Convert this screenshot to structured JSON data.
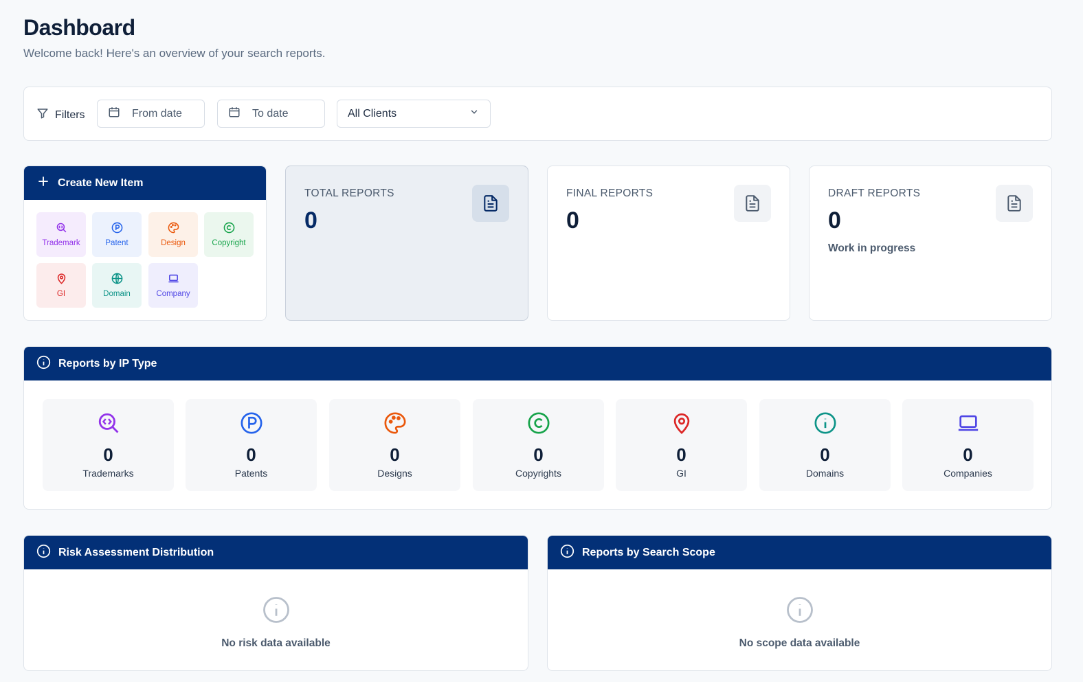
{
  "header": {
    "title": "Dashboard",
    "subtitle": "Welcome back! Here's an overview of your search reports."
  },
  "filters": {
    "label": "Filters",
    "from_date_placeholder": "From date",
    "to_date_placeholder": "To date",
    "client_select": "All Clients"
  },
  "create": {
    "title": "Create New Item",
    "items": [
      {
        "label": "Trademark",
        "icon": "trademark-search-icon",
        "color": "#9333ea",
        "bg": "#f5ecfd"
      },
      {
        "label": "Patent",
        "icon": "patent-icon",
        "color": "#2563eb",
        "bg": "#ecf2fd"
      },
      {
        "label": "Design",
        "icon": "palette-icon",
        "color": "#ea580c",
        "bg": "#fdf1e8"
      },
      {
        "label": "Copyright",
        "icon": "copyright-icon",
        "color": "#16a34a",
        "bg": "#ebf7ee"
      },
      {
        "label": "GI",
        "icon": "map-pin-icon",
        "color": "#dc2626",
        "bg": "#fcecec"
      },
      {
        "label": "Domain",
        "icon": "globe-icon",
        "color": "#0d9488",
        "bg": "#e8f6f4"
      },
      {
        "label": "Company",
        "icon": "laptop-icon",
        "color": "#4f46e5",
        "bg": "#efeefd"
      }
    ]
  },
  "stats": {
    "total": {
      "label": "TOTAL REPORTS",
      "value": "0"
    },
    "final": {
      "label": "FINAL REPORTS",
      "value": "0"
    },
    "draft": {
      "label": "DRAFT REPORTS",
      "value": "0",
      "sub": "Work in progress"
    }
  },
  "ip_types": {
    "title": "Reports by IP Type",
    "items": [
      {
        "label": "Trademarks",
        "value": "0",
        "icon": "trademark-search-icon",
        "color": "#9333ea"
      },
      {
        "label": "Patents",
        "value": "0",
        "icon": "patent-icon",
        "color": "#2563eb"
      },
      {
        "label": "Designs",
        "value": "0",
        "icon": "palette-icon",
        "color": "#ea580c"
      },
      {
        "label": "Copyrights",
        "value": "0",
        "icon": "copyright-icon",
        "color": "#16a34a"
      },
      {
        "label": "GI",
        "value": "0",
        "icon": "map-pin-icon",
        "color": "#dc2626"
      },
      {
        "label": "Domains",
        "value": "0",
        "icon": "info-circle-icon",
        "color": "#0d9488"
      },
      {
        "label": "Companies",
        "value": "0",
        "icon": "laptop-icon",
        "color": "#4f46e5"
      }
    ]
  },
  "risk": {
    "title": "Risk Assessment Distribution",
    "empty": "No risk data available"
  },
  "scope": {
    "title": "Reports by Search Scope",
    "empty": "No scope data available"
  },
  "colors": {
    "primary": "#033077",
    "background": "#f7f9fb"
  }
}
